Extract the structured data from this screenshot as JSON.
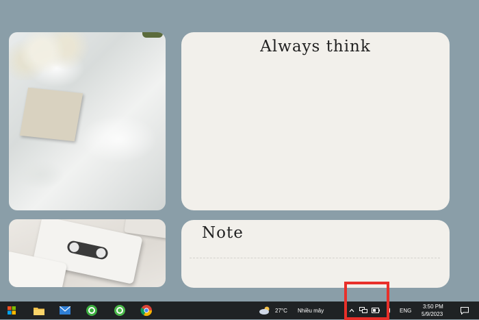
{
  "widgets": {
    "always_card_title": "Always think",
    "note_card_title": "Note"
  },
  "taskbar": {
    "weather_temp": "27°C",
    "weather_desc": "Nhiều mây",
    "language": "ENG",
    "time": "3:50 PM",
    "date": "5/9/2023",
    "pinned_apps": [
      "windows-start-icon",
      "file-explorer-icon",
      "mail-icon",
      "green-app-icon",
      "green-app-icon-2",
      "chrome-icon"
    ],
    "tray_icons": [
      "chevron-up-icon",
      "network-icon",
      "battery-icon",
      "speaker-icon"
    ]
  },
  "colors": {
    "desktop_bg": "#8a9ea8",
    "card_bg": "#f2f0eb",
    "taskbar_bg": "#1f2224",
    "highlight": "#e8302a"
  }
}
